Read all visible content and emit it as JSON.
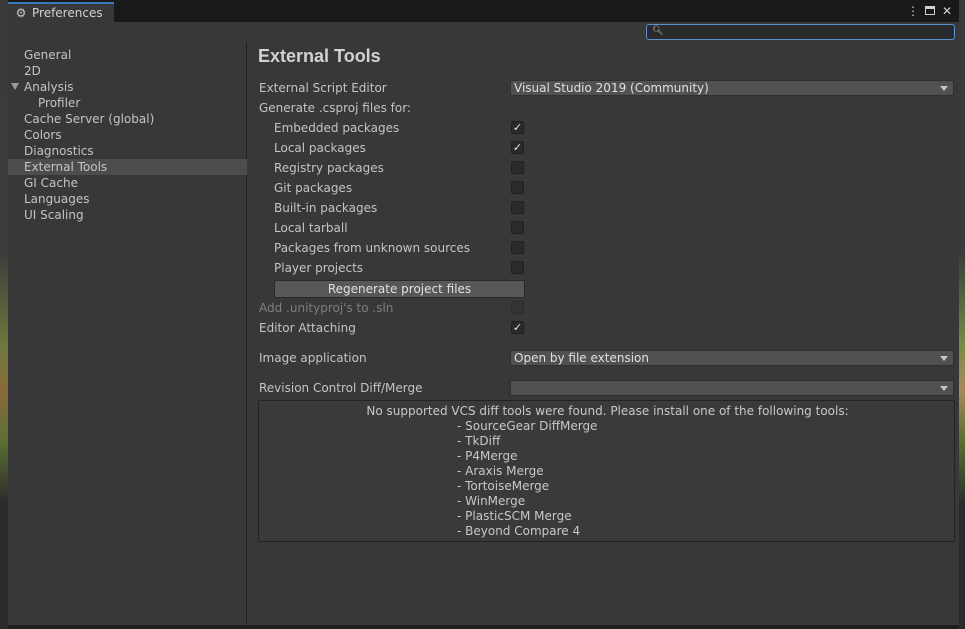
{
  "window": {
    "tab_title": "Preferences",
    "gear_icon": "gear-icon",
    "menu_glyph": "⋮",
    "close_glyph": "✕"
  },
  "search": {
    "placeholder": "",
    "value": ""
  },
  "sidebar": {
    "items": [
      {
        "label": "General"
      },
      {
        "label": "2D"
      },
      {
        "label": "Analysis"
      },
      {
        "label": "Profiler"
      },
      {
        "label": "Cache Server (global)"
      },
      {
        "label": "Colors"
      },
      {
        "label": "Diagnostics"
      },
      {
        "label": "External Tools"
      },
      {
        "label": "GI Cache"
      },
      {
        "label": "Languages"
      },
      {
        "label": "UI Scaling"
      }
    ],
    "selected": "External Tools"
  },
  "main": {
    "title": "External Tools",
    "script_editor_label": "External Script Editor",
    "script_editor_value": "Visual Studio 2019 (Community)",
    "generate_label": "Generate .csproj files for:",
    "packages": [
      {
        "label": "Embedded packages",
        "checked": true
      },
      {
        "label": "Local packages",
        "checked": true
      },
      {
        "label": "Registry packages",
        "checked": false
      },
      {
        "label": "Git packages",
        "checked": false
      },
      {
        "label": "Built-in packages",
        "checked": false
      },
      {
        "label": "Local tarball",
        "checked": false
      },
      {
        "label": "Packages from unknown sources",
        "checked": false
      },
      {
        "label": "Player projects",
        "checked": false
      }
    ],
    "regenerate_label": "Regenerate project files",
    "add_unityproj_label": "Add .unityproj's to .sln",
    "add_unityproj_checked": false,
    "editor_attaching_label": "Editor Attaching",
    "editor_attaching_checked": true,
    "image_app_label": "Image application",
    "image_app_value": "Open by file extension",
    "revision_label": "Revision Control Diff/Merge",
    "revision_value": "",
    "check_glyph": "✓",
    "vcs_message": "No supported VCS diff tools were found. Please install one of the following tools:",
    "vcs_tools": [
      "- SourceGear DiffMerge",
      "- TkDiff",
      "- P4Merge",
      "- Araxis Merge",
      "- TortoiseMerge",
      "- WinMerge",
      "- PlasticSCM Merge",
      "- Beyond Compare 4"
    ]
  }
}
